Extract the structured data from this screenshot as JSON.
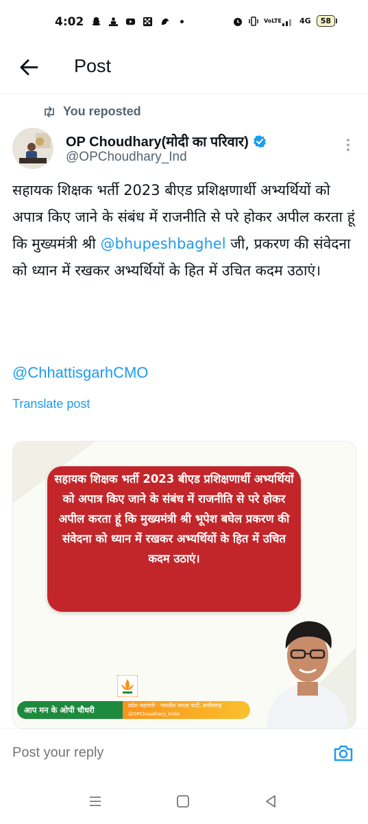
{
  "status_bar": {
    "time": "4:02",
    "network_label": "VoLTE",
    "network_type": "4G",
    "battery": "58"
  },
  "header": {
    "title": "Post"
  },
  "repost": {
    "label": "You reposted"
  },
  "author": {
    "name": "OP Choudhary(मोदी का परिवार)",
    "handle": "@OPChoudhary_Ind",
    "verified_color": "#1d9bf0"
  },
  "post": {
    "text_before": "सहायक शिक्षक भर्ती 2023 बीएड प्रशिक्षणार्थी अभ्यर्थियों को अपात्र किए जाने के संबंध में राजनीति से परे होकर अपील करता हूं कि मुख्यमंत्री श्री ",
    "mention_1": "@bhupeshbaghel",
    "text_after": "  जी, प्रकरण की संवेदना को ध्यान में रखकर अभ्यर्थियों के हित में  उचित कदम उठाएं।",
    "mention_2": "@ChhattisgarhCMO",
    "translate_label": "Translate post"
  },
  "media": {
    "card_text": "सहायक शिक्षक भर्ती 2023 बीएड प्रशिक्षणार्थी अभ्यर्थियों को अपात्र किए जाने के संबंध में राजनीति से परे होकर अपील करता हूं कि मुख्यमंत्री श्री भूपेश बघेल प्रकरण की संवेदना को ध्यान में रखकर अभ्यर्थियों के हित में  उचित कदम उठाएं।",
    "banner_left": "आप मन के ओपी चौधरी",
    "banner_right_line1": "प्रदेश महामंत्री · भारतीय जनता पार्टी, छत्तीसगढ़",
    "banner_right_line2": "@OPChoudhary_India",
    "accent_red": "#c3262a",
    "banner_green": "#1e8a3e",
    "banner_orange": "#f7941d"
  },
  "reply": {
    "placeholder": "Post your reply"
  },
  "colors": {
    "link_blue": "#1d9bf0",
    "secondary_text": "#536471"
  }
}
